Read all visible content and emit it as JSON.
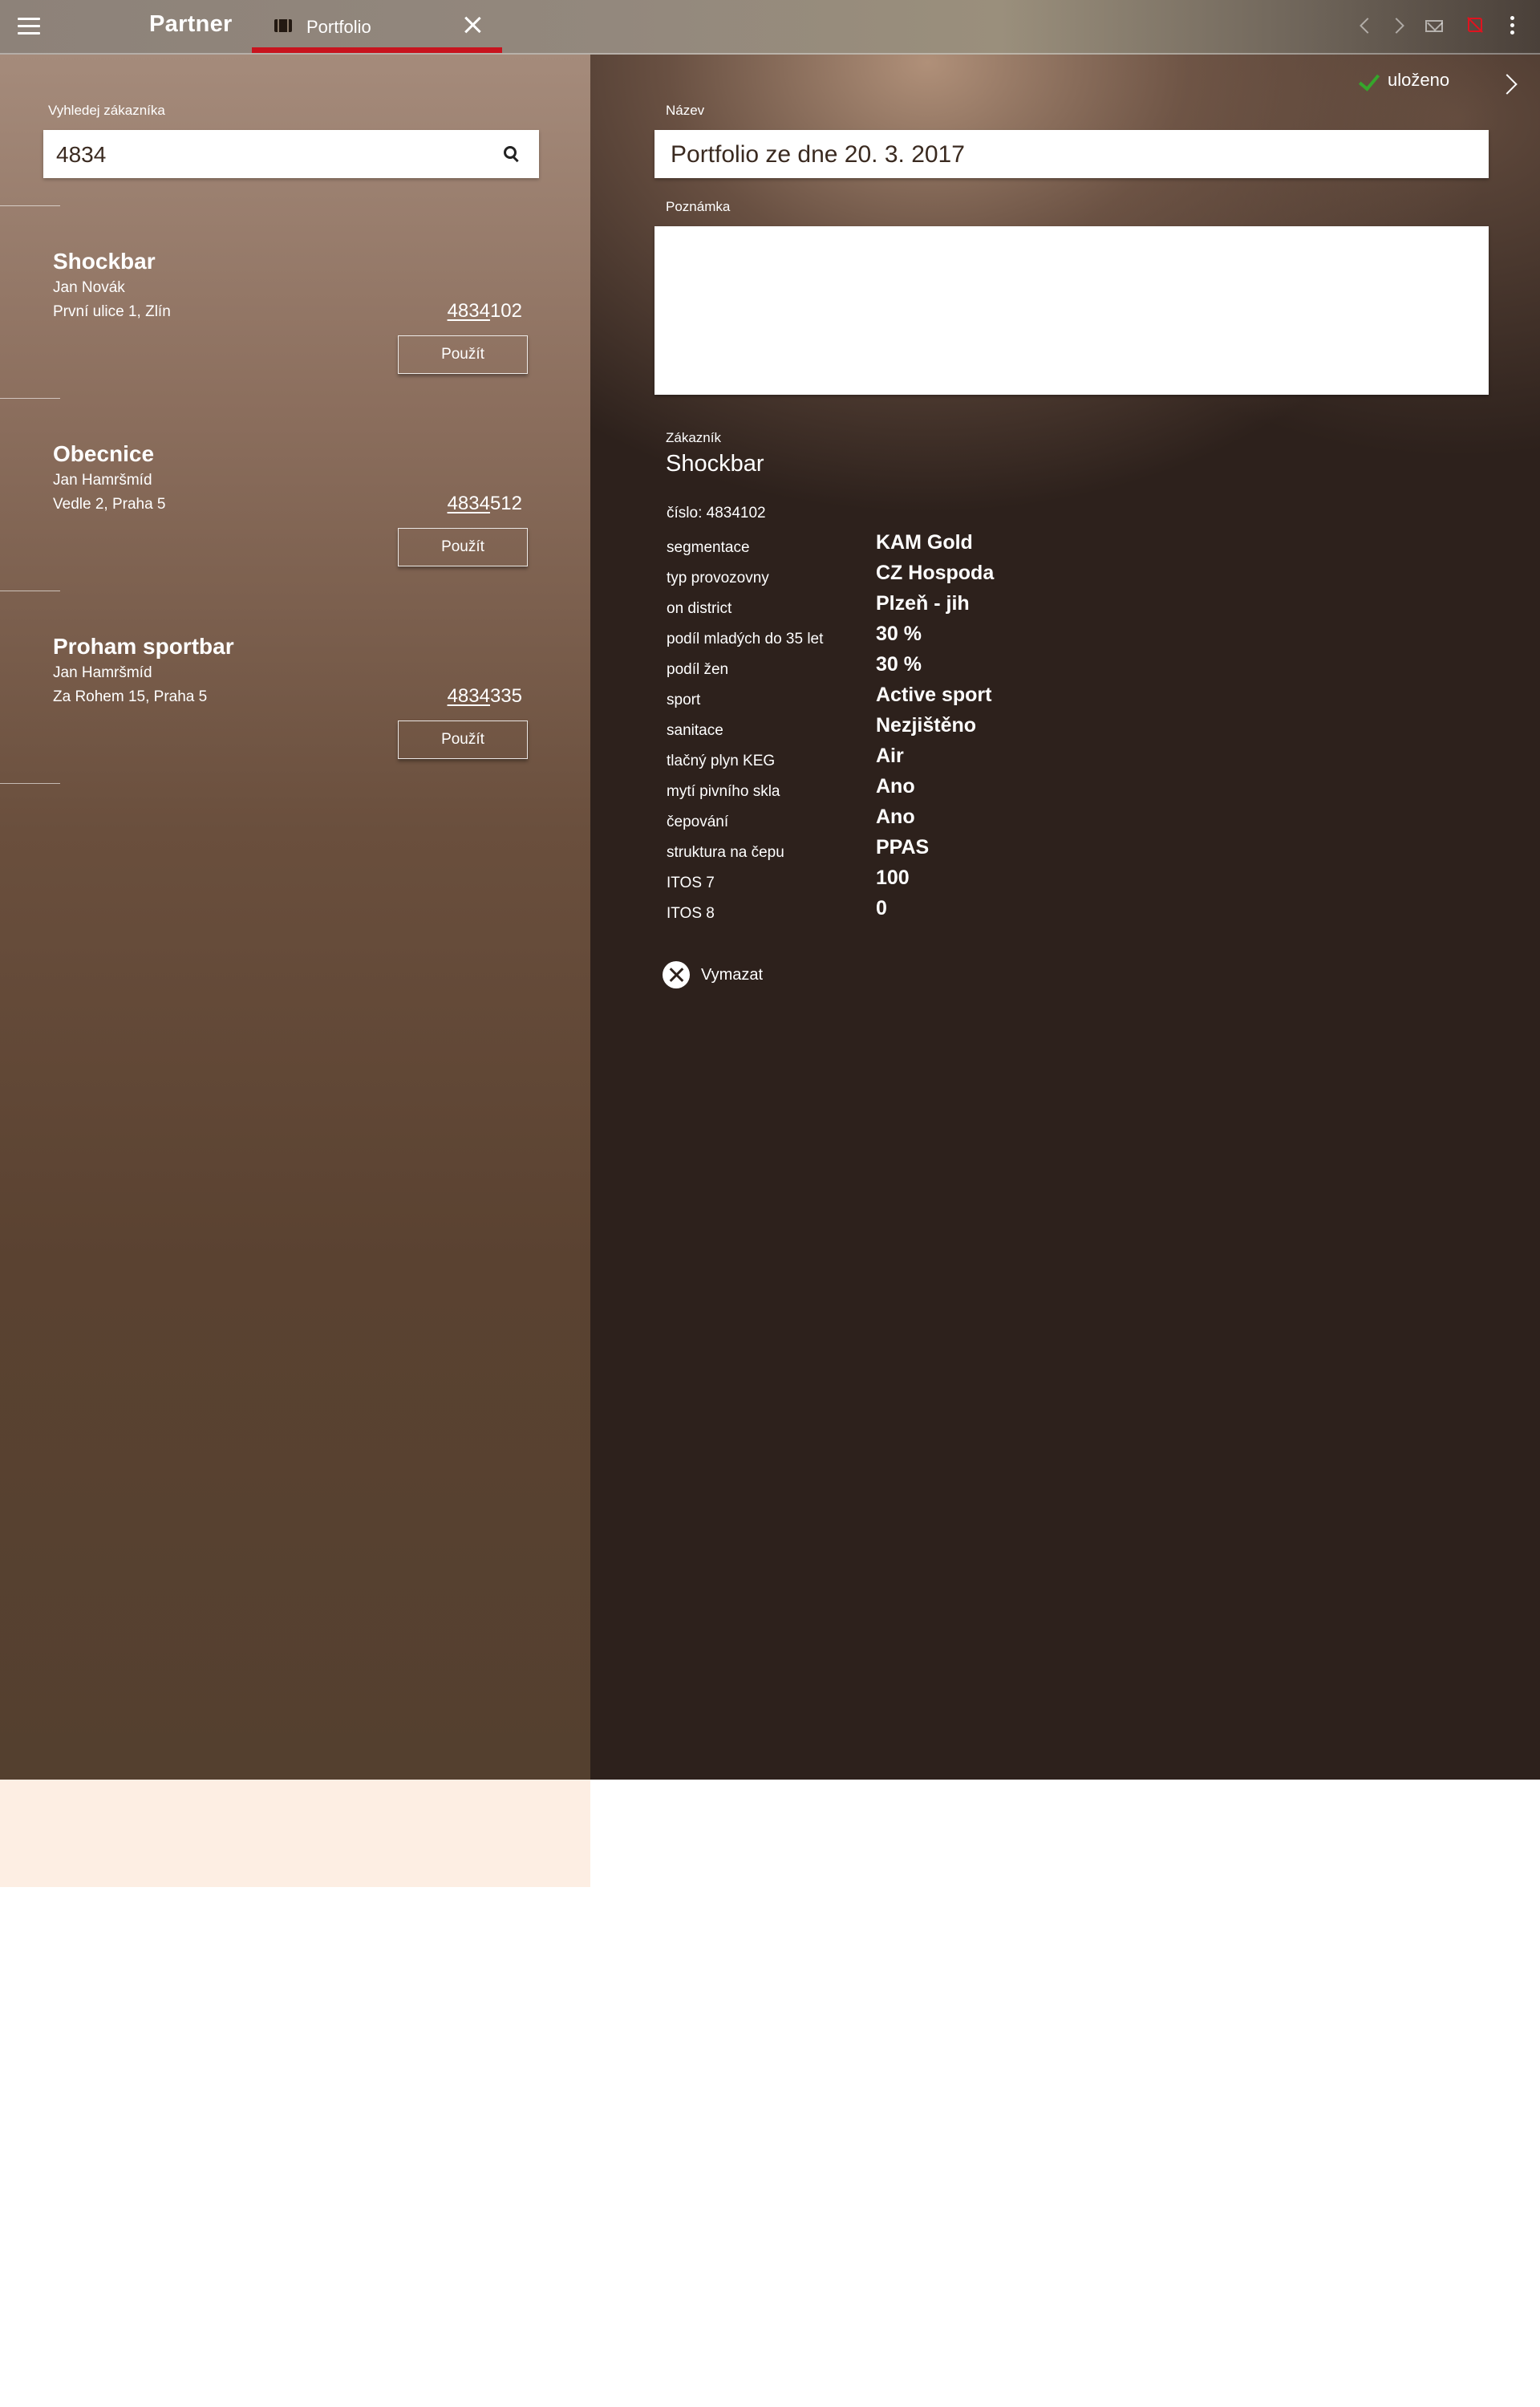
{
  "app": {
    "brand": "Partner",
    "tab_label": "Portfolio"
  },
  "icons": {
    "menu": "hamburger-menu-icon",
    "tab": "portfolio-icon",
    "close": "close-icon",
    "back": "chevron-left-icon",
    "forward": "chevron-right-icon",
    "mail": "mail-icon",
    "sync": "sync-disabled-icon",
    "more": "more-vertical-icon",
    "search": "search-icon",
    "saved": "check-icon",
    "delete": "x-circle-icon"
  },
  "colors": {
    "accent_red": "#c8141e",
    "saved_green": "#35a62b",
    "sync_error_red": "#e0131f"
  },
  "search": {
    "label": "Vyhledej zákazníka",
    "value": "4834"
  },
  "results": [
    {
      "name": "Shockbar",
      "contact": "Jan Novák",
      "address": "První ulice 1, Zlín",
      "number_match": "4834",
      "number_rest": "102",
      "button": "Použít"
    },
    {
      "name": "Obecnice",
      "contact": "Jan Hamršmíd",
      "address": "Vedle 2, Praha 5",
      "number_match": "4834",
      "number_rest": "512",
      "button": "Použít"
    },
    {
      "name": "Proham sportbar",
      "contact": "Jan Hamršmíd",
      "address": "Za Rohem 15, Praha 5",
      "number_match": "4834",
      "number_rest": "335",
      "button": "Použít"
    }
  ],
  "status": {
    "saved": "uloženo"
  },
  "form": {
    "name_label": "Název",
    "name_value": "Portfolio ze dne 20. 3. 2017",
    "note_label": "Poznámka",
    "note_value": ""
  },
  "customer": {
    "label": "Zákazník",
    "name": "Shockbar",
    "number": "číslo: 4834102",
    "attributes": [
      {
        "label": "segmentace",
        "value": "KAM Gold"
      },
      {
        "label": "typ provozovny",
        "value": "CZ Hospoda"
      },
      {
        "label": "on district",
        "value": "Plzeň - jih"
      },
      {
        "label": "podíl mladých do 35 let",
        "value": "30 %"
      },
      {
        "label": "podíl žen",
        "value": "30 %"
      },
      {
        "label": "sport",
        "value": "Active sport"
      },
      {
        "label": "sanitace",
        "value": "Nezjištěno"
      },
      {
        "label": "tlačný plyn KEG",
        "value": "Air"
      },
      {
        "label": "mytí pivního skla",
        "value": "Ano"
      },
      {
        "label": "čepování",
        "value": "Ano"
      },
      {
        "label": "struktura na čepu",
        "value": "PPAS"
      },
      {
        "label": "ITOS 7",
        "value": "100"
      },
      {
        "label": "ITOS 8",
        "value": "0"
      }
    ]
  },
  "actions": {
    "delete": "Vymazat"
  }
}
